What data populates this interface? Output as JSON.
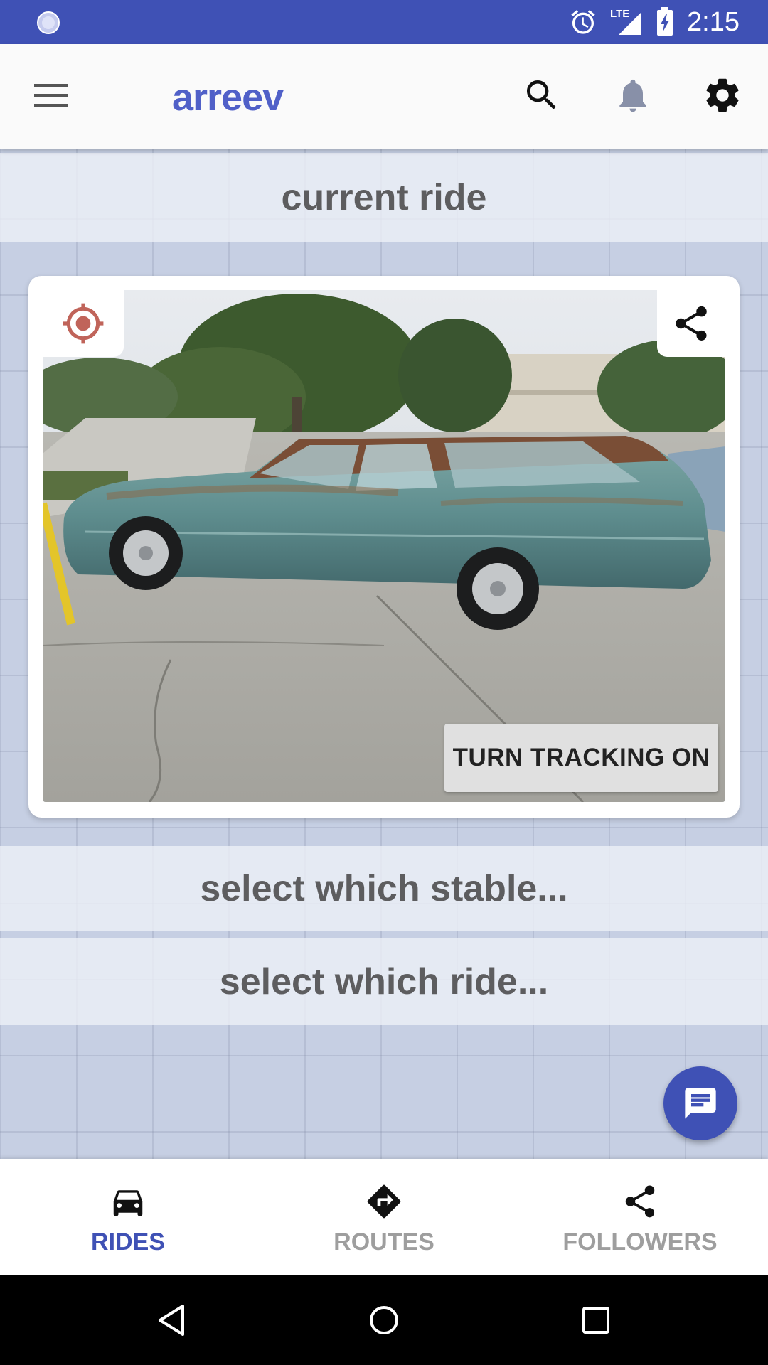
{
  "status_bar": {
    "time": "2:15",
    "network": "LTE",
    "icons": [
      "loading-spinner-icon",
      "alarm-icon",
      "lte-signal-icon",
      "battery-charging-icon"
    ]
  },
  "app_bar": {
    "title": "arreev",
    "icons": [
      "menu-icon",
      "search-icon",
      "notifications-bell-icon",
      "settings-gear-icon"
    ],
    "colors": {
      "title": "#5060c8",
      "background": "#fafafa"
    }
  },
  "current_ride": {
    "header": "current ride",
    "tracking_button_label": "TURN TRACKING ON",
    "photo_alt": "vintage teal station wagon",
    "icons": [
      "my-location-icon",
      "share-icon"
    ]
  },
  "selectors": {
    "stable_label": "select which stable...",
    "ride_label": "select which ride..."
  },
  "fab": {
    "icon": "chat-message-icon"
  },
  "bottom_nav": {
    "items": [
      {
        "label": "RIDES",
        "icon": "car-icon",
        "active": true
      },
      {
        "label": "ROUTES",
        "icon": "directions-icon",
        "active": false
      },
      {
        "label": "FOLLOWERS",
        "icon": "share-icon",
        "active": false
      }
    ],
    "colors": {
      "active": "#3f51b5",
      "inactive": "#9e9e9e"
    }
  },
  "system_nav": {
    "icons": [
      "back-icon",
      "home-icon",
      "recents-icon"
    ]
  },
  "theme": {
    "primary": "#3f51b5"
  }
}
